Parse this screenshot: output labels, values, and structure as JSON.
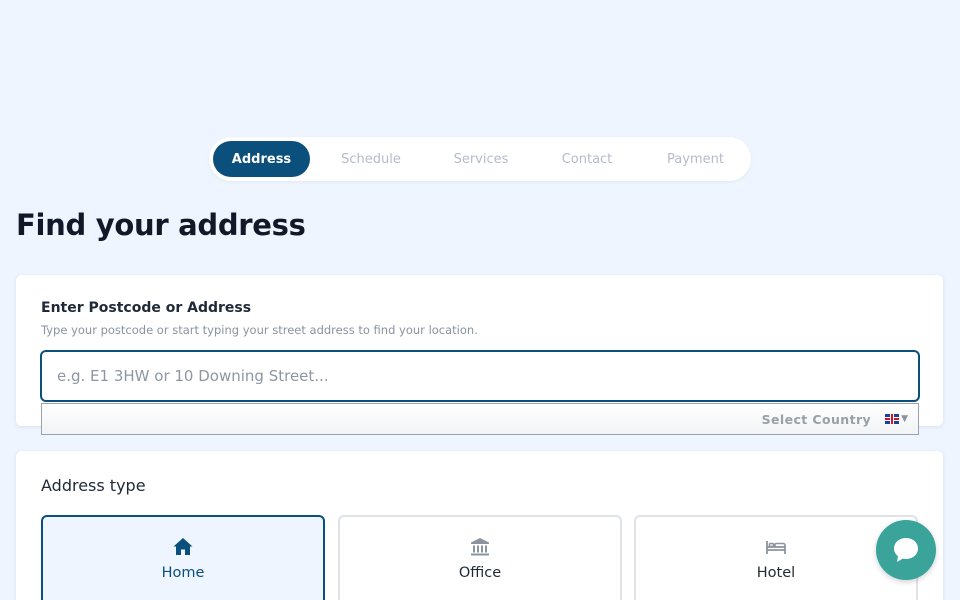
{
  "steps": [
    {
      "label": "Address",
      "active": true
    },
    {
      "label": "Schedule",
      "active": false
    },
    {
      "label": "Services",
      "active": false
    },
    {
      "label": "Contact",
      "active": false
    },
    {
      "label": "Payment",
      "active": false
    }
  ],
  "page": {
    "title": "Find your address"
  },
  "address": {
    "label": "Enter Postcode or Address",
    "help": "Type your postcode or start typing your street address to find your location.",
    "placeholder": "e.g. E1 3HW or 10 Downing Street...",
    "value": "",
    "country_label": "Select Country",
    "country_flag_icon": "uk-flag-icon"
  },
  "address_type": {
    "label": "Address type",
    "options": [
      {
        "label": "Home",
        "icon": "house-icon",
        "selected": true
      },
      {
        "label": "Office",
        "icon": "building-icon",
        "selected": false
      },
      {
        "label": "Hotel",
        "icon": "bed-icon",
        "selected": false
      }
    ]
  },
  "chat": {
    "icon": "chat-bubble-icon"
  },
  "colors": {
    "background": "#eef5ff",
    "accent": "#0b4f7d",
    "chat": "#3aa39a",
    "inactive_text": "#b5bcc8"
  }
}
